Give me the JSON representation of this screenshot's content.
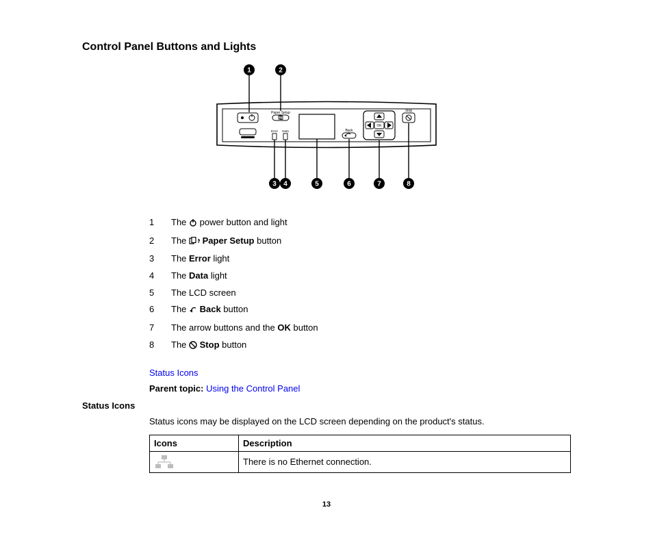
{
  "title": "Control Panel Buttons and Lights",
  "legend": [
    {
      "n": "1",
      "pre": "The ",
      "bold": "",
      "post": " power button and light",
      "glyph": "power"
    },
    {
      "n": "2",
      "pre": "The ",
      "bold": "Paper Setup",
      "post": " button",
      "glyph": "papersetup"
    },
    {
      "n": "3",
      "pre": "The ",
      "bold": "Error",
      "post": " light",
      "glyph": ""
    },
    {
      "n": "4",
      "pre": "The ",
      "bold": "Data",
      "post": " light",
      "glyph": ""
    },
    {
      "n": "5",
      "pre": "The LCD screen",
      "bold": "",
      "post": "",
      "glyph": ""
    },
    {
      "n": "6",
      "pre": "The ",
      "bold": "Back",
      "post": " button",
      "glyph": "back"
    },
    {
      "n": "7",
      "pre": "The arrow buttons and the ",
      "bold": "OK",
      "post": " button",
      "glyph": ""
    },
    {
      "n": "8",
      "pre": "The ",
      "bold": "Stop",
      "post": " button",
      "glyph": "stop"
    }
  ],
  "links": {
    "status_icons": "Status Icons",
    "parent_label": "Parent topic:",
    "parent_link": "Using the Control Panel"
  },
  "subhead": "Status Icons",
  "para": "Status icons may be displayed on the LCD screen depending on the product's status.",
  "table": {
    "h1": "Icons",
    "h2": "Description",
    "row1_desc": "There is no Ethernet connection."
  },
  "diagram_labels": {
    "paper_setup": "Paper Setup",
    "error": "Error",
    "data": "Data",
    "back": "Back",
    "ok": "OK",
    "stop": "Stop"
  },
  "page_number": "13"
}
